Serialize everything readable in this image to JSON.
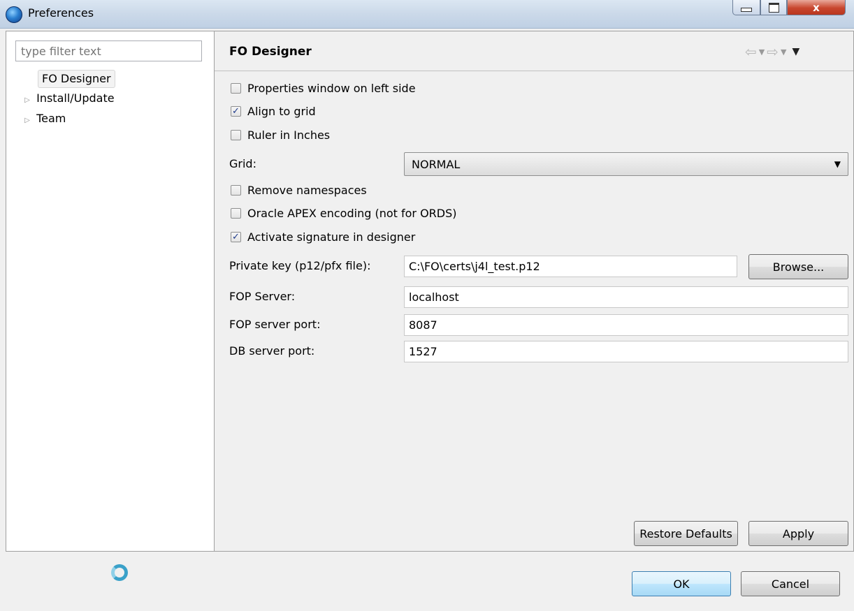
{
  "window": {
    "title": "Preferences",
    "close_glyph": "x",
    "icons": [
      "app-icon",
      "minimize-icon",
      "maximize-icon",
      "close-icon"
    ]
  },
  "sidebar": {
    "filter_placeholder": "type filter text",
    "items": [
      {
        "label": "FO Designer",
        "expandable": false,
        "selected": true
      },
      {
        "label": "Install/Update",
        "expandable": true,
        "selected": false
      },
      {
        "label": "Team",
        "expandable": true,
        "selected": false
      }
    ]
  },
  "page": {
    "title": "FO Designer",
    "nav_icons": [
      "back-arrow-icon",
      "dropdown-icon",
      "forward-arrow-icon",
      "dropdown-icon",
      "view-menu-icon"
    ]
  },
  "options": {
    "properties_left": {
      "label": "Properties window on left side",
      "checked": false
    },
    "align_grid": {
      "label": "Align to grid",
      "checked": true
    },
    "ruler_inches": {
      "label": "Ruler in Inches",
      "checked": false
    },
    "remove_namespaces": {
      "label": "Remove namespaces",
      "checked": false
    },
    "apex_encoding": {
      "label": "Oracle APEX encoding (not for ORDS)",
      "checked": false
    },
    "activate_signature": {
      "label": "Activate signature in designer",
      "checked": true
    }
  },
  "grid": {
    "label": "Grid:",
    "value": "NORMAL"
  },
  "private_key": {
    "label": "Private key (p12/pfx file):",
    "value": "C:\\FO\\certs\\j4l_test.p12",
    "browse_label": "Browse..."
  },
  "fop_server": {
    "label": "FOP Server:",
    "value": "localhost"
  },
  "fop_port": {
    "label": "FOP server port:",
    "value": "8087"
  },
  "db_port": {
    "label": "DB server port:",
    "value": "1527"
  },
  "buttons": {
    "restore_defaults": "Restore Defaults",
    "apply": "Apply",
    "ok": "OK",
    "cancel": "Cancel"
  },
  "check_glyph": "✓",
  "colors": {
    "accent": "#3c7fb1",
    "progress": "#3aa1c9"
  }
}
